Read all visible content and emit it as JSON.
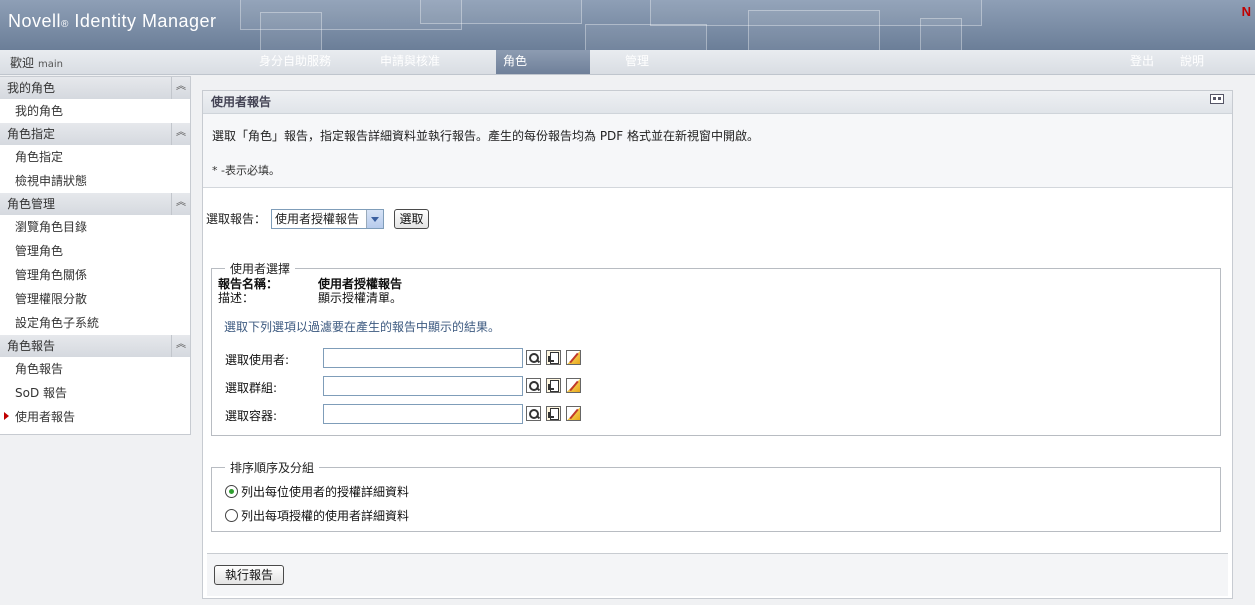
{
  "header": {
    "brand": "Novell",
    "brand_reg": "®",
    "brand_product": " Identity Manager",
    "logo_letter": "N"
  },
  "nav": {
    "welcome": "歡迎",
    "user": "main",
    "tabs": [
      "身分自助服務",
      "申請與核准",
      "角色",
      "管理"
    ],
    "active_tab": "角色",
    "right_links": [
      "登出",
      "說明"
    ]
  },
  "sidebar": {
    "sections": [
      {
        "title": "我的角色",
        "items": [
          "我的角色"
        ]
      },
      {
        "title": "角色指定",
        "items": [
          "角色指定",
          "檢視申請狀態"
        ]
      },
      {
        "title": "角色管理",
        "items": [
          "瀏覽角色目錄",
          "管理角色",
          "管理角色關係",
          "管理權限分散",
          "設定角色子系統"
        ]
      },
      {
        "title": "角色報告",
        "items": [
          "角色報告",
          "SoD 報告",
          "使用者報告"
        ]
      }
    ],
    "current_item": "使用者報告"
  },
  "panel": {
    "title": "使用者報告",
    "intro": "選取「角色」報告，指定報告詳細資料並執行報告。產生的每份報告均為 PDF 格式並在新視窗中開啟。",
    "required_note": "* -表示必填。",
    "select_label": "選取報告：",
    "select_value": "使用者授權報告",
    "select_button": "選取",
    "user_selection": {
      "legend": "使用者選擇",
      "name_label": "報告名稱：",
      "name_value": "使用者授權報告",
      "desc_label": "描述：",
      "desc_value": "顯示授權清單。",
      "hint": "選取下列選項以過濾要在產生的報告中顯示的結果。",
      "fields": [
        {
          "label": "選取使用者:",
          "value": ""
        },
        {
          "label": "選取群組:",
          "value": ""
        },
        {
          "label": "選取容器:",
          "value": ""
        }
      ]
    },
    "sort": {
      "legend": "排序順序及分組",
      "options": [
        "列出每位使用者的授權詳細資料",
        "列出每項授權的使用者詳細資料"
      ],
      "selected_index": 0
    },
    "run_button": "執行報告"
  },
  "icons": [
    "search-icon",
    "history-icon",
    "edit-icon",
    "collapse-icon",
    "panel-menu-icon"
  ],
  "colors": {
    "header": "#7b8da6",
    "accent_red": "#c00000",
    "hint_text": "#3d5a80"
  }
}
